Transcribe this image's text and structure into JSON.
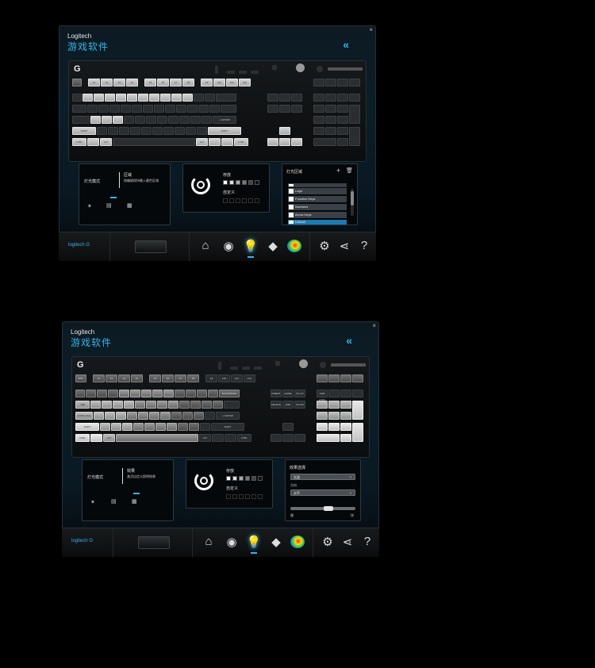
{
  "colors": {
    "accent": "#3ab4ea",
    "background": "#000000",
    "key_lit": "#c8c8c8"
  },
  "window1": {
    "brand": "Logitech",
    "title": "游戏软件",
    "close": "×",
    "collapse": "«",
    "lighting": {
      "label": "灯光模式",
      "region_label": "区域",
      "region_desc": "按编键保持最入最色区域"
    },
    "color_panel": {
      "label": "存放",
      "custom_label": "自定义"
    },
    "regions": {
      "label": "灯光区域",
      "add": "+",
      "delete_icon": "trash-icon",
      "items": [
        "Logo",
        "Function Keys",
        "Numbers",
        "Arrow Keys",
        "Default"
      ],
      "selected_index": 4
    },
    "footer": {
      "logo": "logitech G"
    }
  },
  "window2": {
    "brand": "Logitech",
    "title": "游戏软件",
    "close": "×",
    "collapse": "«",
    "lighting": {
      "label": "灯光模式",
      "region_label": "效果",
      "region_desc": "激活自定义照明效果"
    },
    "color_panel": {
      "label": "存放",
      "custom_label": "自定义"
    },
    "effects": {
      "label": "效果选择",
      "effect_value": "光波",
      "direction_label": "方向",
      "direction_value": "水平",
      "speed_slow": "慢",
      "speed_fast": "快",
      "speed": 0.6
    },
    "footer": {
      "logo": "logitech G"
    }
  },
  "keys": {
    "esc": "ESC",
    "f1": "F1",
    "f2": "F2",
    "f3": "F3",
    "f4": "F4",
    "f5": "F5",
    "f6": "F6",
    "f7": "F7",
    "f8": "F8",
    "f9": "F9",
    "f10": "F10",
    "f11": "F11",
    "f12": "F12",
    "tab": "TAB",
    "caps": "CAPS LOCK",
    "shift": "SHIFT",
    "ctrl": "CTRL",
    "alt": "ALT",
    "enter": "↵ ENTER",
    "backspace": "BACKSPACE",
    "insert": "INSERT",
    "home": "HOME",
    "pgup": "PG UP",
    "delete": "DELETE",
    "end": "END",
    "pgdn": "PG DN",
    "numlock": "NUM LOCK"
  }
}
